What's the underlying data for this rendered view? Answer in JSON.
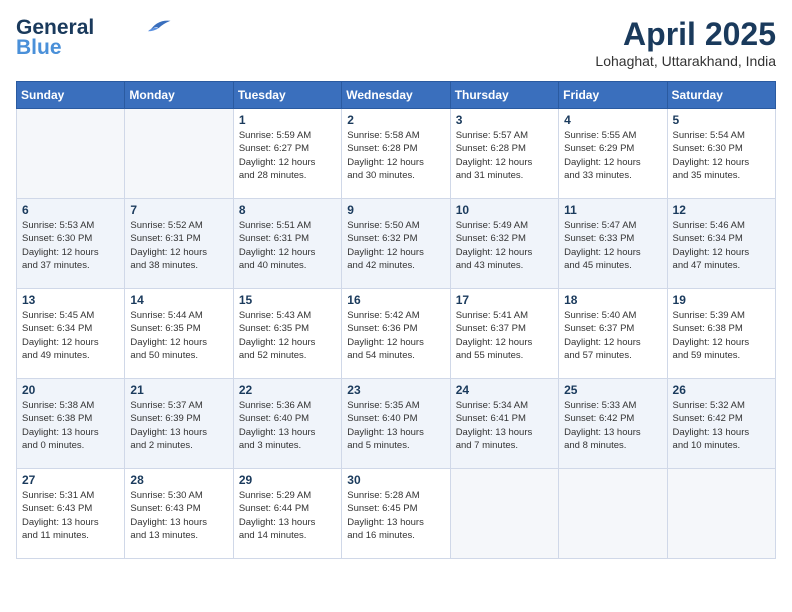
{
  "header": {
    "logo_line1": "General",
    "logo_line2": "Blue",
    "month_year": "April 2025",
    "location": "Lohaghat, Uttarakhand, India"
  },
  "weekdays": [
    "Sunday",
    "Monday",
    "Tuesday",
    "Wednesday",
    "Thursday",
    "Friday",
    "Saturday"
  ],
  "weeks": [
    [
      {
        "day": "",
        "detail": ""
      },
      {
        "day": "",
        "detail": ""
      },
      {
        "day": "1",
        "detail": "Sunrise: 5:59 AM\nSunset: 6:27 PM\nDaylight: 12 hours\nand 28 minutes."
      },
      {
        "day": "2",
        "detail": "Sunrise: 5:58 AM\nSunset: 6:28 PM\nDaylight: 12 hours\nand 30 minutes."
      },
      {
        "day": "3",
        "detail": "Sunrise: 5:57 AM\nSunset: 6:28 PM\nDaylight: 12 hours\nand 31 minutes."
      },
      {
        "day": "4",
        "detail": "Sunrise: 5:55 AM\nSunset: 6:29 PM\nDaylight: 12 hours\nand 33 minutes."
      },
      {
        "day": "5",
        "detail": "Sunrise: 5:54 AM\nSunset: 6:30 PM\nDaylight: 12 hours\nand 35 minutes."
      }
    ],
    [
      {
        "day": "6",
        "detail": "Sunrise: 5:53 AM\nSunset: 6:30 PM\nDaylight: 12 hours\nand 37 minutes."
      },
      {
        "day": "7",
        "detail": "Sunrise: 5:52 AM\nSunset: 6:31 PM\nDaylight: 12 hours\nand 38 minutes."
      },
      {
        "day": "8",
        "detail": "Sunrise: 5:51 AM\nSunset: 6:31 PM\nDaylight: 12 hours\nand 40 minutes."
      },
      {
        "day": "9",
        "detail": "Sunrise: 5:50 AM\nSunset: 6:32 PM\nDaylight: 12 hours\nand 42 minutes."
      },
      {
        "day": "10",
        "detail": "Sunrise: 5:49 AM\nSunset: 6:32 PM\nDaylight: 12 hours\nand 43 minutes."
      },
      {
        "day": "11",
        "detail": "Sunrise: 5:47 AM\nSunset: 6:33 PM\nDaylight: 12 hours\nand 45 minutes."
      },
      {
        "day": "12",
        "detail": "Sunrise: 5:46 AM\nSunset: 6:34 PM\nDaylight: 12 hours\nand 47 minutes."
      }
    ],
    [
      {
        "day": "13",
        "detail": "Sunrise: 5:45 AM\nSunset: 6:34 PM\nDaylight: 12 hours\nand 49 minutes."
      },
      {
        "day": "14",
        "detail": "Sunrise: 5:44 AM\nSunset: 6:35 PM\nDaylight: 12 hours\nand 50 minutes."
      },
      {
        "day": "15",
        "detail": "Sunrise: 5:43 AM\nSunset: 6:35 PM\nDaylight: 12 hours\nand 52 minutes."
      },
      {
        "day": "16",
        "detail": "Sunrise: 5:42 AM\nSunset: 6:36 PM\nDaylight: 12 hours\nand 54 minutes."
      },
      {
        "day": "17",
        "detail": "Sunrise: 5:41 AM\nSunset: 6:37 PM\nDaylight: 12 hours\nand 55 minutes."
      },
      {
        "day": "18",
        "detail": "Sunrise: 5:40 AM\nSunset: 6:37 PM\nDaylight: 12 hours\nand 57 minutes."
      },
      {
        "day": "19",
        "detail": "Sunrise: 5:39 AM\nSunset: 6:38 PM\nDaylight: 12 hours\nand 59 minutes."
      }
    ],
    [
      {
        "day": "20",
        "detail": "Sunrise: 5:38 AM\nSunset: 6:38 PM\nDaylight: 13 hours\nand 0 minutes."
      },
      {
        "day": "21",
        "detail": "Sunrise: 5:37 AM\nSunset: 6:39 PM\nDaylight: 13 hours\nand 2 minutes."
      },
      {
        "day": "22",
        "detail": "Sunrise: 5:36 AM\nSunset: 6:40 PM\nDaylight: 13 hours\nand 3 minutes."
      },
      {
        "day": "23",
        "detail": "Sunrise: 5:35 AM\nSunset: 6:40 PM\nDaylight: 13 hours\nand 5 minutes."
      },
      {
        "day": "24",
        "detail": "Sunrise: 5:34 AM\nSunset: 6:41 PM\nDaylight: 13 hours\nand 7 minutes."
      },
      {
        "day": "25",
        "detail": "Sunrise: 5:33 AM\nSunset: 6:42 PM\nDaylight: 13 hours\nand 8 minutes."
      },
      {
        "day": "26",
        "detail": "Sunrise: 5:32 AM\nSunset: 6:42 PM\nDaylight: 13 hours\nand 10 minutes."
      }
    ],
    [
      {
        "day": "27",
        "detail": "Sunrise: 5:31 AM\nSunset: 6:43 PM\nDaylight: 13 hours\nand 11 minutes."
      },
      {
        "day": "28",
        "detail": "Sunrise: 5:30 AM\nSunset: 6:43 PM\nDaylight: 13 hours\nand 13 minutes."
      },
      {
        "day": "29",
        "detail": "Sunrise: 5:29 AM\nSunset: 6:44 PM\nDaylight: 13 hours\nand 14 minutes."
      },
      {
        "day": "30",
        "detail": "Sunrise: 5:28 AM\nSunset: 6:45 PM\nDaylight: 13 hours\nand 16 minutes."
      },
      {
        "day": "",
        "detail": ""
      },
      {
        "day": "",
        "detail": ""
      },
      {
        "day": "",
        "detail": ""
      }
    ]
  ]
}
